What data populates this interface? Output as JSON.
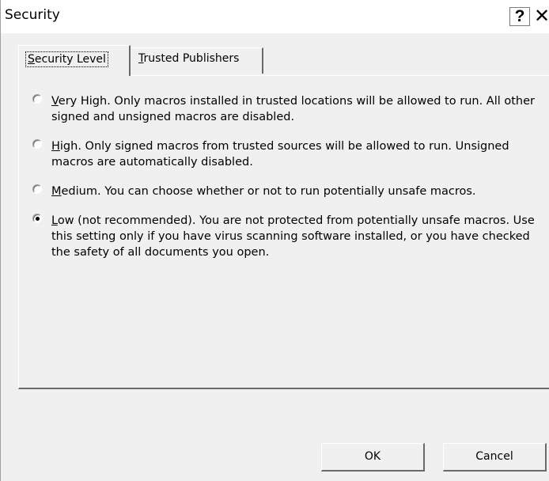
{
  "window": {
    "title": "Security",
    "help_label": "?",
    "close_label": "✕"
  },
  "tabs": [
    {
      "mnemonic": "S",
      "rest": "ecurity Level",
      "active": true
    },
    {
      "mnemonic": "T",
      "rest": "rusted Publishers",
      "active": false
    }
  ],
  "options": [
    {
      "mnemonic": "V",
      "rest": "ery High. Only macros installed in trusted locations will be allowed to run. All other signed and unsigned macros are disabled.",
      "checked": false
    },
    {
      "mnemonic": "H",
      "rest": "igh. Only signed macros from trusted sources will be allowed to run. Unsigned macros are automatically disabled.",
      "checked": false
    },
    {
      "mnemonic": "M",
      "rest": "edium. You can choose whether or not to run potentially unsafe macros.",
      "checked": false
    },
    {
      "mnemonic": "L",
      "rest": "ow (not recommended). You are not protected from potentially unsafe macros. Use this setting only if you have virus scanning software installed, or you have checked the safety of all documents you open.",
      "checked": true
    }
  ],
  "buttons": {
    "ok_label": "OK",
    "cancel_label": "Cancel"
  }
}
